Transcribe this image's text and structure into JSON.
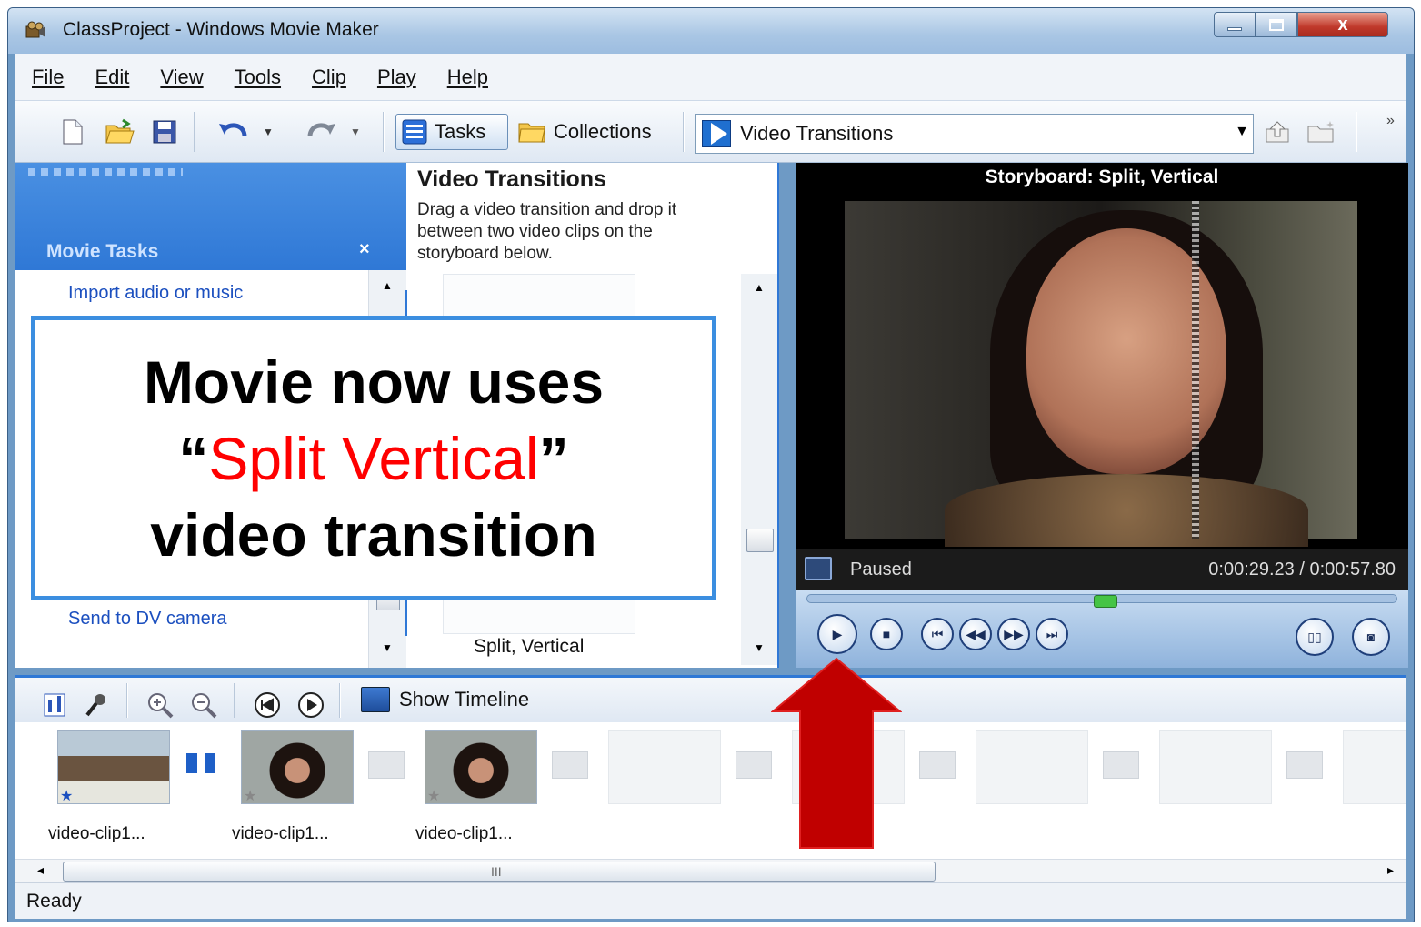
{
  "window": {
    "title": "ClassProject - Windows Movie Maker",
    "close_glyph": "x"
  },
  "menu": [
    "File",
    "Edit",
    "View",
    "Tools",
    "Clip",
    "Play",
    "Help"
  ],
  "toolbar": {
    "tasks_label": "Tasks",
    "collections_label": "Collections",
    "combo_value": "Video Transitions",
    "overflow_glyph": "»"
  },
  "task_pane": {
    "title": "Movie Tasks",
    "close_glyph": "×",
    "links": [
      "Import audio or music",
      "Send to DV camera"
    ]
  },
  "transitions_pane": {
    "title": "Video Transitions",
    "description": "Drag a video transition and drop it between two video clips on the storyboard below.",
    "selected_caption": "Split, Vertical"
  },
  "monitor": {
    "title": "Storyboard: Split, Vertical",
    "state": "Paused",
    "time": "0:00:29.23 / 0:00:57.80",
    "progress_fraction": 0.506
  },
  "storyboard_toolbar": {
    "show_timeline_label": "Show Timeline"
  },
  "storyboard": {
    "clips": [
      {
        "label": "video-clip1..."
      },
      {
        "label": "video-clip1..."
      },
      {
        "label": "video-clip1..."
      }
    ]
  },
  "hscroll": {
    "grip": "III"
  },
  "status": {
    "text": "Ready"
  },
  "callout": {
    "line1": "Movie now uses",
    "open_quote": "“",
    "highlight": "Split Vertical",
    "close_quote": "”",
    "line3": "video transition"
  },
  "colors": {
    "accent_blue": "#2f78d6",
    "callout_border": "#3b8ee0",
    "highlight_red": "#ff0000",
    "arrow_red": "#c00000"
  }
}
